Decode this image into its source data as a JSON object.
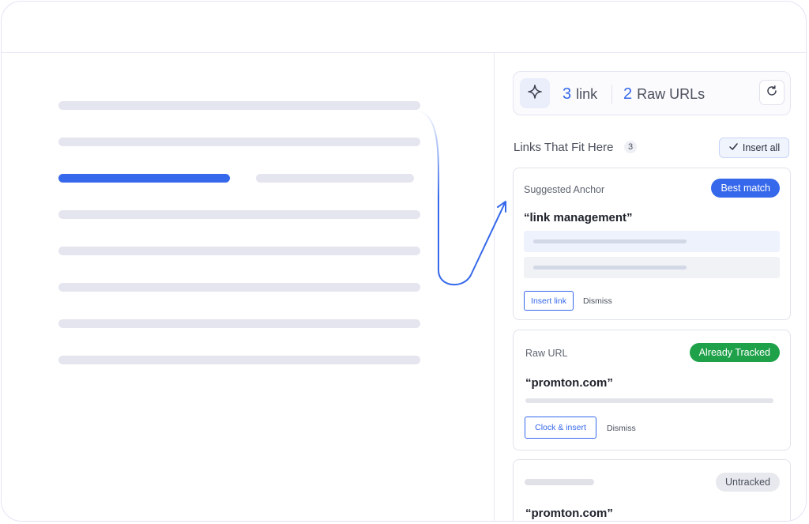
{
  "stats": {
    "link_count": "3",
    "link_label": "link",
    "raw_count": "2",
    "raw_label": "Raw URLs"
  },
  "section": {
    "title": "Links That Fit Here",
    "count": "3",
    "insert_all_label": "Insert all"
  },
  "cards": [
    {
      "label": "Suggested Anchor",
      "badge": "Best match",
      "anchor": "“link management”",
      "primary_action": "Insert link",
      "secondary_action": "Dismiss"
    },
    {
      "label": "Raw URL",
      "badge": "Already Tracked",
      "anchor": "“promton.com”",
      "primary_action": "Clock & insert",
      "secondary_action": "Dismiss"
    },
    {
      "label": "",
      "badge": "Untracked",
      "anchor": "“promton.com”"
    }
  ],
  "icons": {
    "sparkle": "sparkle-icon",
    "refresh": "refresh-icon",
    "check": "check-icon"
  },
  "colors": {
    "accent": "#3568ea",
    "success": "#1fa14a",
    "neutral_badge": "#e8e9ee"
  }
}
